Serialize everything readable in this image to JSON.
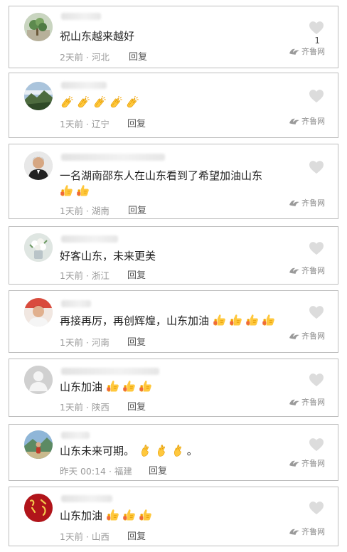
{
  "colors": {
    "border": "#bdbdbd",
    "text": "#222222",
    "meta": "#9a9a9a",
    "reply": "#555555",
    "heart": "#dcdcdc",
    "emoji_yellow": "#f4b400"
  },
  "watermark_text": "齐鲁网",
  "comments": [
    {
      "text": "祝山东越来越好",
      "emoji": "",
      "emoji_count": 0,
      "time_location": "2天前 · 河北",
      "reply": "回复",
      "like_count": "1",
      "avatar": "avatar-plant"
    },
    {
      "text": "",
      "emoji": "clapping-hands-icon",
      "emoji_count": 5,
      "time_location": "1天前 · 辽宁",
      "reply": "回复",
      "like_count": "",
      "avatar": "avatar-landscape"
    },
    {
      "text": "一名湖南邵东人在山东看到了希望加油山东",
      "emoji": "thumbs-up-icon",
      "emoji_count": 2,
      "time_location": "1天前 · 湖南",
      "reply": "回复",
      "like_count": "",
      "avatar": "avatar-man"
    },
    {
      "text": "好客山东，未来更美",
      "emoji": "",
      "emoji_count": 0,
      "time_location": "1天前 · 浙江",
      "reply": "回复",
      "like_count": "",
      "avatar": "avatar-flowers"
    },
    {
      "text": "再接再厉，再创辉煌，山东加油",
      "emoji": "thumbs-up-icon",
      "emoji_count": 4,
      "time_location": "1天前 · 河南",
      "reply": "回复",
      "like_count": "",
      "avatar": "avatar-person-red"
    },
    {
      "text": "山东加油",
      "emoji": "thumbs-up-icon",
      "emoji_count": 3,
      "time_location": "1天前 · 陕西",
      "reply": "回复",
      "like_count": "",
      "avatar": "avatar-default"
    },
    {
      "text": "山东未来可期。",
      "emoji": "crossed-fingers-icon",
      "emoji_count": 3,
      "emoji_suffix": "。",
      "time_location": "昨天 00:14 · 福建",
      "reply": "回复",
      "like_count": "",
      "avatar": "avatar-outdoor"
    },
    {
      "text": "山东加油",
      "emoji": "thumbs-up-icon",
      "emoji_count": 3,
      "time_location": "1天前 · 山西",
      "reply": "回复",
      "like_count": "",
      "avatar": "avatar-red-calligraphy"
    }
  ]
}
